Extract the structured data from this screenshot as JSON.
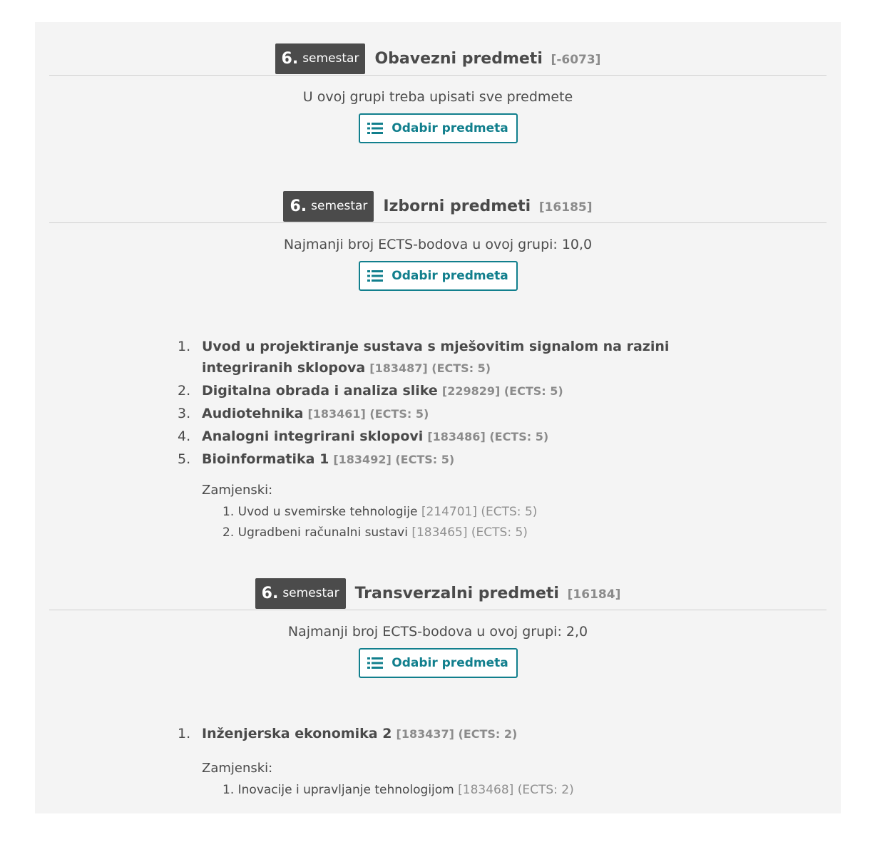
{
  "groups": [
    {
      "semester_number": "6.",
      "semester_word": "semestar",
      "title": "Obavezni predmeti",
      "code": "[-6073]",
      "note": "U ovoj grupi treba upisati sve predmete",
      "button_label": "Odabir predmeta",
      "courses": [],
      "alternatives_label": "",
      "alternatives": []
    },
    {
      "semester_number": "6.",
      "semester_word": "semestar",
      "title": "Izborni predmeti",
      "code": "[16185]",
      "note": "Najmanji broj ECTS-bodova u ovoj grupi: 10,0",
      "button_label": "Odabir predmeta",
      "courses": [
        {
          "num": "1.",
          "name": "Uvod u projektiranje sustava s mješovitim signalom na razini integriranih sklopova",
          "meta": "[183487] (ECTS: 5)"
        },
        {
          "num": "2.",
          "name": "Digitalna obrada i analiza slike",
          "meta": "[229829] (ECTS: 5)"
        },
        {
          "num": "3.",
          "name": "Audiotehnika",
          "meta": "[183461] (ECTS: 5)"
        },
        {
          "num": "4.",
          "name": "Analogni integrirani sklopovi",
          "meta": "[183486] (ECTS: 5)"
        },
        {
          "num": "5.",
          "name": "Bioinformatika 1",
          "meta": "[183492] (ECTS: 5)"
        }
      ],
      "alternatives_label": "Zamjenski:",
      "alternatives": [
        {
          "num": "1.",
          "name": "Uvod u svemirske tehnologije",
          "meta": "[214701] (ECTS: 5)"
        },
        {
          "num": "2.",
          "name": "Ugradbeni računalni sustavi",
          "meta": "[183465] (ECTS: 5)"
        }
      ]
    },
    {
      "semester_number": "6.",
      "semester_word": "semestar",
      "title": "Transverzalni predmeti",
      "code": "[16184]",
      "note": "Najmanji broj ECTS-bodova u ovoj grupi: 2,0",
      "button_label": "Odabir predmeta",
      "courses": [
        {
          "num": "1.",
          "name": "Inženjerska ekonomika 2",
          "meta": "[183437] (ECTS: 2)"
        }
      ],
      "alternatives_label": "Zamjenski:",
      "alternatives": [
        {
          "num": "1.",
          "name": "Inovacije i upravljanje tehnologijom",
          "meta": "[183468] (ECTS: 2)"
        }
      ]
    }
  ],
  "colors": {
    "accent": "#117f8d",
    "badge_bg": "#4b4b4b",
    "panel_bg": "#f4f4f4",
    "muted_text": "#8b8b8b"
  },
  "icons": {
    "button_icon": "list-icon"
  }
}
